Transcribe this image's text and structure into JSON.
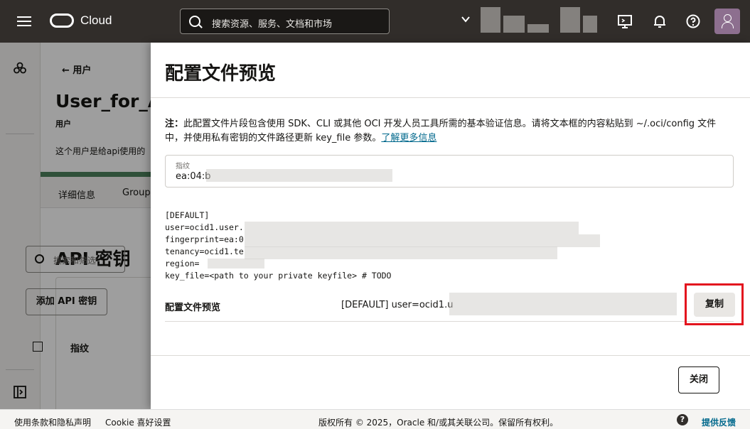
{
  "header": {
    "brand": "Cloud",
    "search_placeholder": "搜索资源、服务、文档和市场"
  },
  "background_page": {
    "back_link": "用户",
    "user_title": "User_for_A",
    "user_subtitle": "用户",
    "description": "这个用户是给api使用的",
    "tabs": [
      "详细信息",
      "Group"
    ],
    "section_title": "API 密钥",
    "search_placeholder": "搜索和筛选",
    "add_button": "添加 API 密钥",
    "column_header": "指纹"
  },
  "drawer": {
    "title": "配置文件预览",
    "note_bold": "注：",
    "note_text": "此配置文件片段包含使用 SDK、CLI 或其他 OCI 开发人员工具所需的基本验证信息。请将文本框的内容粘贴到 ~/.oci/config 文件中，并使用私有密钥的文件路径更新 key_file 参数。",
    "note_link": "了解更多信息",
    "fingerprint_label": "指纹",
    "fingerprint_value": "ea:04:b",
    "code_lines": [
      "[DEFAULT]",
      "user=ocid1.user.",
      "fingerprint=ea:0",
      "tenancy=ocid1.te",
      "region=",
      "key_file=<path to your private keyfile> # TODO"
    ],
    "preview_label": "配置文件预览",
    "preview_value": "[DEFAULT] user=ocid1.u",
    "copy_button": "复制",
    "close_button": "关闭"
  },
  "footer": {
    "terms": "使用条款和隐私声明",
    "cookie": "Cookie 喜好设置",
    "copyright": "版权所有 © 2025，Oracle 和/或其关联公司。保留所有权利。",
    "help_icon": "?",
    "feedback": "提供反馈"
  },
  "colors": {
    "header_bg": "#312d2a",
    "link": "#00688c",
    "highlight": "#e3141e"
  }
}
